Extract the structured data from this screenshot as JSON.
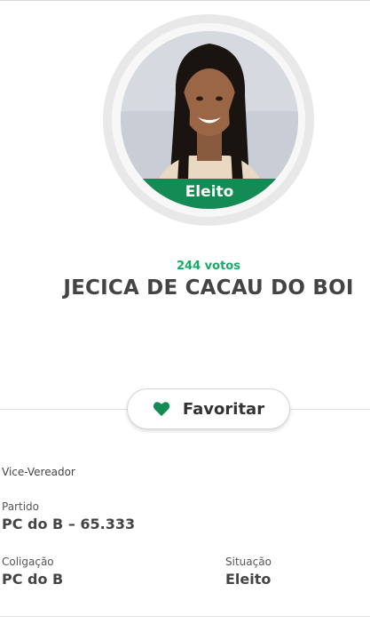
{
  "candidate": {
    "status_badge": "Eleito",
    "votes": "244 votos",
    "name": "JECICA DE CACAU DO BOI",
    "photo_icon": "candidate-photo"
  },
  "actions": {
    "favorite_label": "Favoritar",
    "favorite_icon": "heart-icon"
  },
  "details": {
    "role": "Vice-Vereador",
    "party_label": "Partido",
    "party_value": "PC do B – 65.333",
    "coalition_label": "Coligação",
    "coalition_value": "PC do B",
    "situation_label": "Situação",
    "situation_value": "Eleito"
  },
  "colors": {
    "accent_green": "#148a55",
    "votes_green": "#1aa86a",
    "text_dark": "#444444"
  }
}
